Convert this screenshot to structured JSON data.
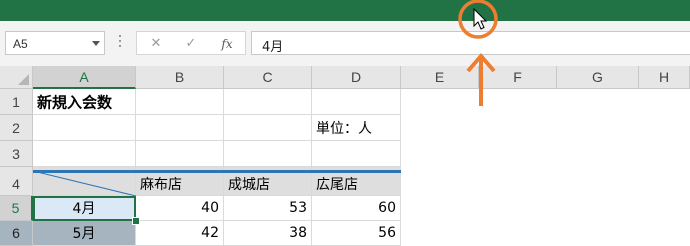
{
  "app": {
    "accent_color": "#217346",
    "annotation_color": "#ed7d31"
  },
  "formula_bar": {
    "name_box": "A5",
    "cancel_icon": "close-icon",
    "enter_icon": "check-icon",
    "function_label": "fx",
    "content": "4月"
  },
  "columns": [
    "A",
    "B",
    "C",
    "D",
    "E",
    "F",
    "G",
    "H"
  ],
  "rows": [
    "1",
    "2",
    "3",
    "4",
    "5",
    "6"
  ],
  "cells": {
    "A1": "新規入会数",
    "D2": "単位：人",
    "B4": "麻布店",
    "C4": "成城店",
    "D4": "広尾店",
    "A5": "4月",
    "B5": "40",
    "C5": "53",
    "D5": "60",
    "A6": "5月",
    "B6": "42",
    "C6": "38",
    "D6": "56"
  },
  "annotation": {
    "arrow_icon": "up-arrow-icon",
    "circle_icon": "highlight-circle-icon",
    "cursor_icon": "mouse-cursor-icon"
  }
}
